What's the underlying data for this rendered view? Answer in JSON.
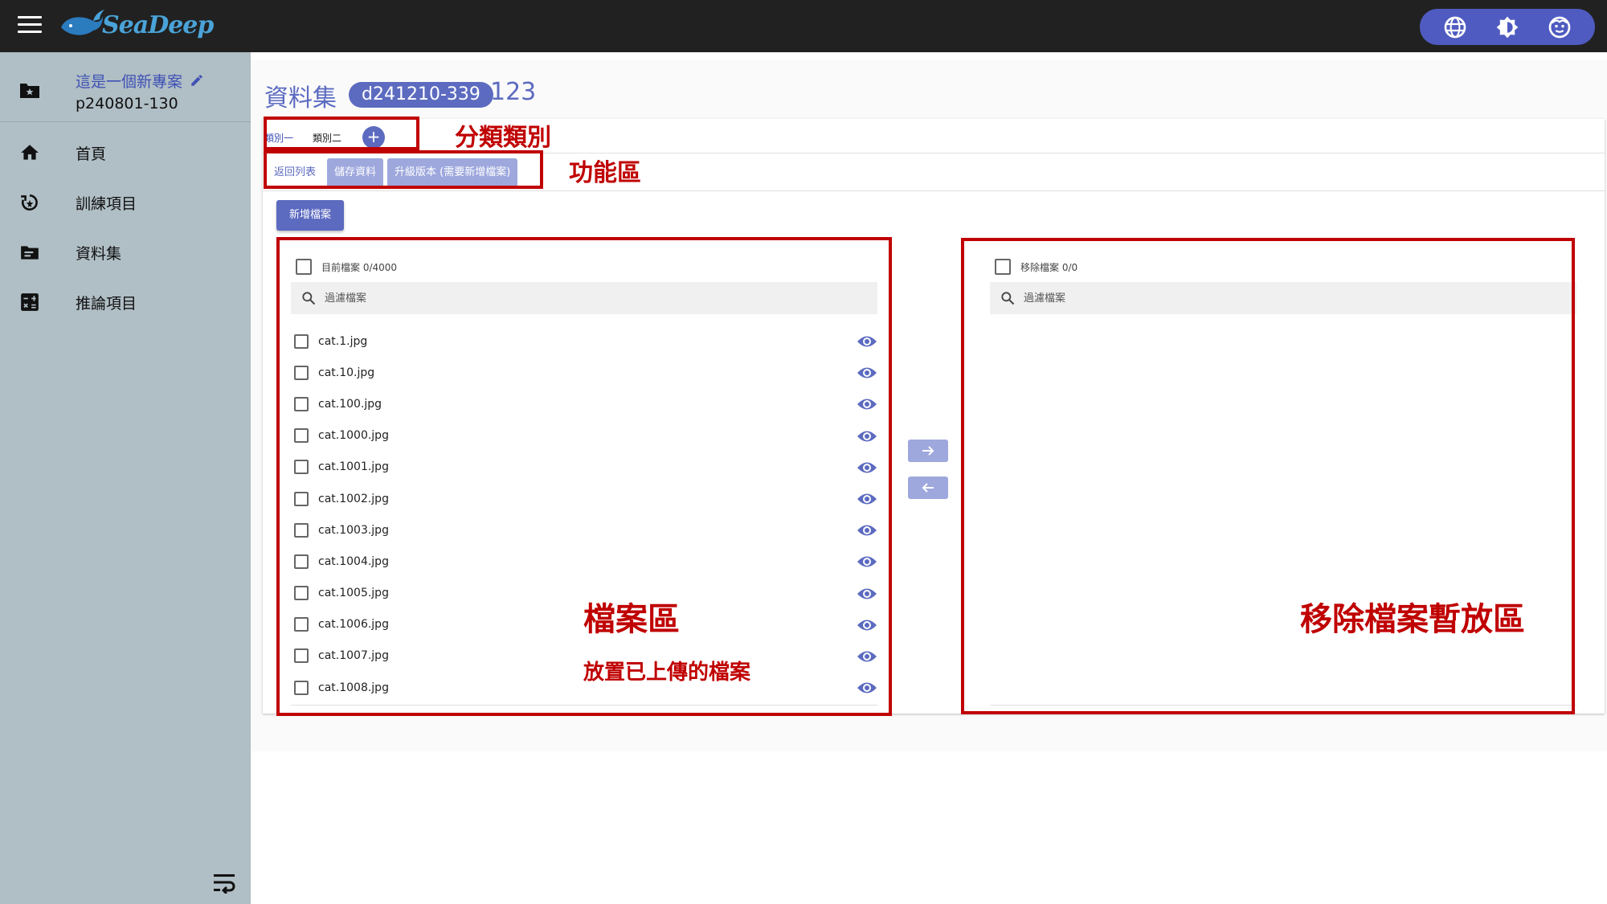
{
  "topbar": {
    "logo_text": "SeaDeep",
    "icons": [
      "menu-icon",
      "globe-icon",
      "brightness-icon",
      "account-icon"
    ]
  },
  "sidebar": {
    "project": {
      "name": "這是一個新專案",
      "id": "p240801-130"
    },
    "items": [
      {
        "label": "首頁",
        "icon": "home-icon"
      },
      {
        "label": "訓練項目",
        "icon": "training-icon"
      },
      {
        "label": "資料集",
        "icon": "folder-icon"
      },
      {
        "label": "推論項目",
        "icon": "calculator-icon"
      }
    ]
  },
  "header": {
    "title": "資料集",
    "dataset_id": "d241210-339",
    "dataset_name": "123"
  },
  "category_tabs": {
    "tabs": [
      "類別一",
      "類別二"
    ],
    "active_index": 0,
    "add_label": "+"
  },
  "function_bar": {
    "back_label": "返回列表",
    "save_label": "儲存資料",
    "upgrade_label": "升級版本 (需要新增檔案)"
  },
  "new_file_label": "新增檔案",
  "current_files": {
    "header": "目前檔案 0/4000",
    "search_placeholder": "過濾檔案",
    "files": [
      "cat.1.jpg",
      "cat.10.jpg",
      "cat.100.jpg",
      "cat.1000.jpg",
      "cat.1001.jpg",
      "cat.1002.jpg",
      "cat.1003.jpg",
      "cat.1004.jpg",
      "cat.1005.jpg",
      "cat.1006.jpg",
      "cat.1007.jpg",
      "cat.1008.jpg"
    ]
  },
  "removed_files": {
    "header": "移除檔案 0/0",
    "search_placeholder": "過濾檔案"
  },
  "annotations": {
    "category_area": "分類類別",
    "function_area": "功能區",
    "file_area": "檔案區",
    "file_area_desc": "放置已上傳的檔案",
    "removed_area": "移除檔案暫放區"
  },
  "colors": {
    "primary": "#5c6bc0",
    "topbar": "#212121",
    "sidebar": "#b0bec5",
    "annotation": "#c00000"
  }
}
